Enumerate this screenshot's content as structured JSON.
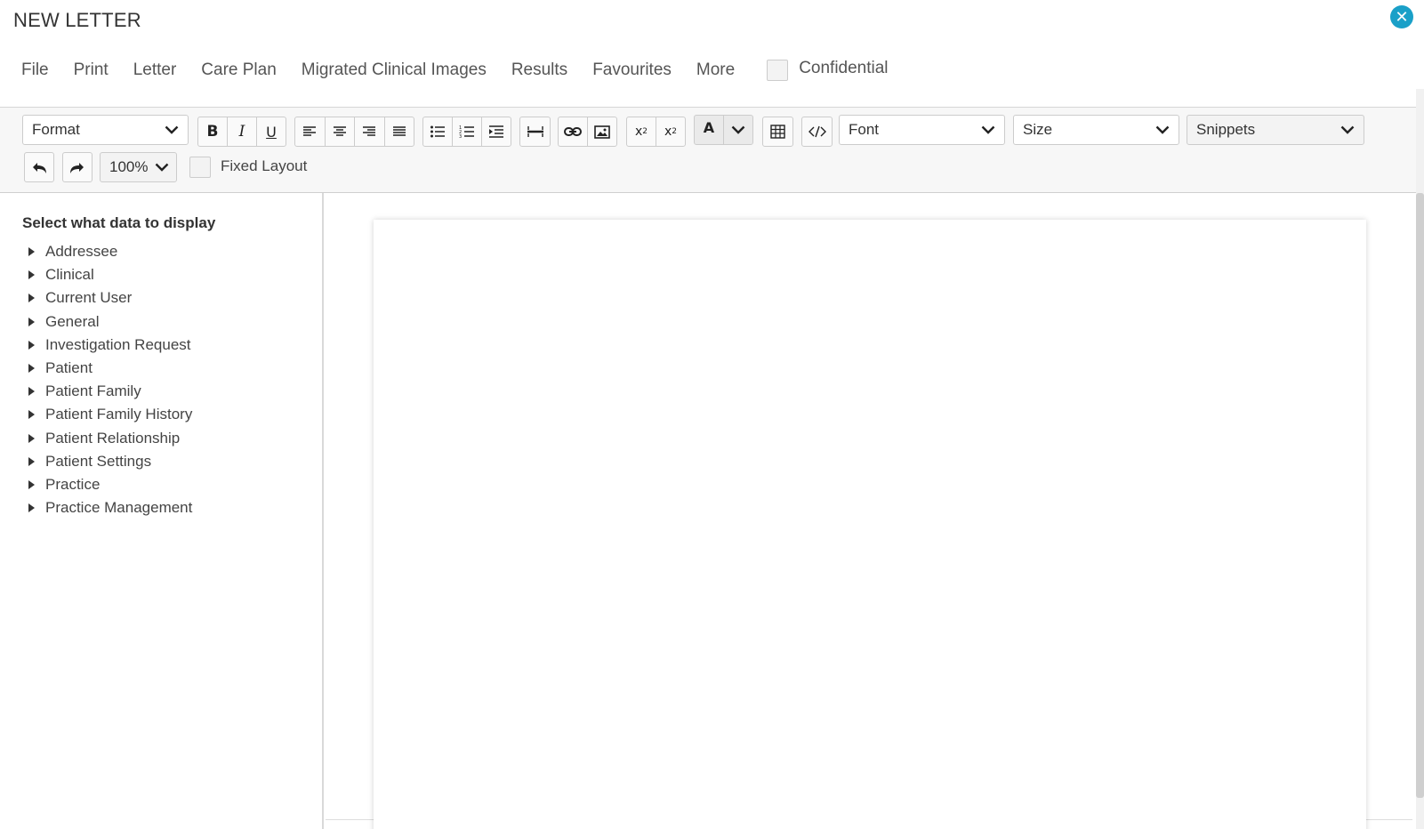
{
  "window": {
    "title": "NEW LETTER",
    "close_icon": "close-icon",
    "accent_color": "#1aa0c8"
  },
  "menu": {
    "items": [
      "File",
      "Print",
      "Letter",
      "Care Plan",
      "Migrated Clinical Images",
      "Results",
      "Favourites",
      "More"
    ],
    "confidential_label": "Confidential",
    "confidential_checked": false
  },
  "toolbar": {
    "format_select": "Format",
    "font_select": "Font",
    "size_select": "Size",
    "snippets_select": "Snippets",
    "zoom_select": "100%",
    "fixed_layout_label": "Fixed Layout",
    "fixed_layout_checked": false,
    "icons": [
      "bold-icon",
      "italic-icon",
      "underline-icon",
      "align-left-icon",
      "align-center-icon",
      "align-right-icon",
      "justify-icon",
      "bullet-list-icon",
      "numbered-list-icon",
      "indent-icon",
      "horizontal-rule-icon",
      "link-icon",
      "image-icon",
      "subscript-icon",
      "superscript-icon",
      "text-color-icon",
      "table-icon",
      "source-code-icon",
      "undo-icon",
      "redo-icon"
    ]
  },
  "sidebar": {
    "heading": "Select what data to display",
    "items": [
      "Addressee",
      "Clinical",
      "Current User",
      "General",
      "Investigation Request",
      "Patient",
      "Patient Family",
      "Patient Family History",
      "Patient Relationship",
      "Patient Settings",
      "Practice",
      "Practice Management"
    ]
  }
}
